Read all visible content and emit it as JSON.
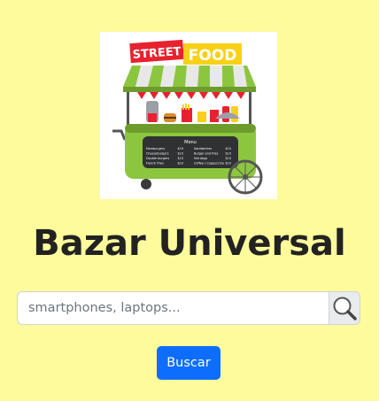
{
  "logo": {
    "line1": "STREET",
    "line2": "FOOD",
    "menu_title": "Menu",
    "menu_rows": [
      [
        "Hamburgers",
        "$10",
        "Sandwiches",
        "$10"
      ],
      [
        "Cheeseburgers",
        "$10",
        "Burger and fries",
        "$10"
      ],
      [
        "Double burgers",
        "$10",
        "Hot dogs",
        "$10"
      ],
      [
        "French fries",
        "$10",
        "Coffee / Cappuccino",
        "$10"
      ]
    ]
  },
  "title": "Bazar Universal",
  "search": {
    "placeholder": "smartphones, laptops...",
    "value": "",
    "icon": "magnifier-icon"
  },
  "submit_label": "Buscar",
  "colors": {
    "page_background": "#fefb9c",
    "primary_button": "#0d6efd",
    "cart_green": "#8cc63f",
    "awning_red": "#e8212e",
    "food_banner_yellow": "#f7d117"
  }
}
